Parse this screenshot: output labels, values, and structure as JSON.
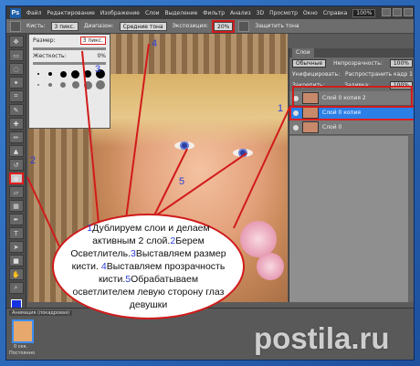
{
  "menubar": {
    "logo": "Ps",
    "items": [
      "Файл",
      "Редактирование",
      "Изображение",
      "Слои",
      "Выделение",
      "Фильтр",
      "Анализ",
      "3D",
      "Просмотр",
      "Окно",
      "Справка"
    ],
    "zoom": "100%"
  },
  "options": {
    "brush_label": "Кисть:",
    "range_label": "Диапазон:",
    "range_value": "Средние тона",
    "exposure_label": "Экспозиция:",
    "exposure_value": "20%",
    "protect_label": "Защитить тона"
  },
  "brush_panel": {
    "size_label": "Размер:",
    "size_value": "3 пикс.",
    "hardness_label": "Жесткость:",
    "hardness_value": "0%"
  },
  "layers_panel": {
    "tab": "Слои",
    "blend_mode": "Обычные",
    "opacity_label": "Непрозрачность:",
    "opacity_value": "100%",
    "unify_label": "Унифицировать:",
    "propagate_label": "Распространить кадр 1",
    "lock_label": "Закрепить:",
    "fill_label": "Заливка:",
    "fill_value": "100%",
    "layers": [
      {
        "name": "Слой 0 копия 2",
        "selected": false
      },
      {
        "name": "Слой 0 копия",
        "selected": true
      },
      {
        "name": "Слой 0",
        "selected": false
      }
    ]
  },
  "animation": {
    "title": "Анимация (покадровая)",
    "frame_time": "0 сек.",
    "loop": "Постоянно"
  },
  "callouts": [
    "1",
    "2",
    "3",
    "4",
    "5"
  ],
  "instructions": {
    "n1": "1",
    "t1": "Дублируем слои и делаем активным 2 слой.",
    "n2": "2",
    "t2": "Берем Осветлитель.",
    "n3": "3",
    "t3": "Выставляем размер кисти.",
    "n4": "4",
    "t4": "Выставляем прозрачность кисти.",
    "n5": "5",
    "t5": "Обрабатываем осветлителем левую сторону глаз девушки"
  },
  "watermark": "postila.ru",
  "colors": {
    "callout_red": "#d11b1b",
    "number_blue": "#2a40d8",
    "selected_layer": "#2c7fe6"
  }
}
